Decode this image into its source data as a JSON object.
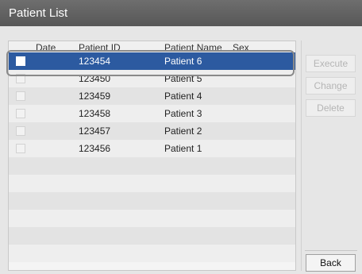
{
  "window": {
    "title": "Patient List"
  },
  "table": {
    "columns": [
      "Date",
      "Patient ID",
      "Patient Name",
      "Sex"
    ],
    "rows": [
      {
        "date": "",
        "patient_id": "123454",
        "patient_name": "Patient 6",
        "sex": ""
      },
      {
        "date": "",
        "patient_id": "123450",
        "patient_name": "Patient 5",
        "sex": ""
      },
      {
        "date": "",
        "patient_id": "123459",
        "patient_name": "Patient 4",
        "sex": ""
      },
      {
        "date": "",
        "patient_id": "123458",
        "patient_name": "Patient 3",
        "sex": ""
      },
      {
        "date": "",
        "patient_id": "123457",
        "patient_name": "Patient 2",
        "sex": ""
      },
      {
        "date": "",
        "patient_id": "123456",
        "patient_name": "Patient 1",
        "sex": ""
      }
    ],
    "empty_rows": 6,
    "selected_index": 0
  },
  "actions": {
    "execute": "Execute",
    "change": "Change",
    "delete": "Delete",
    "back": "Back"
  },
  "colors": {
    "titlebar": "#5f5f5f",
    "selection": "#2c5aa0",
    "background": "#e6e6e6"
  }
}
